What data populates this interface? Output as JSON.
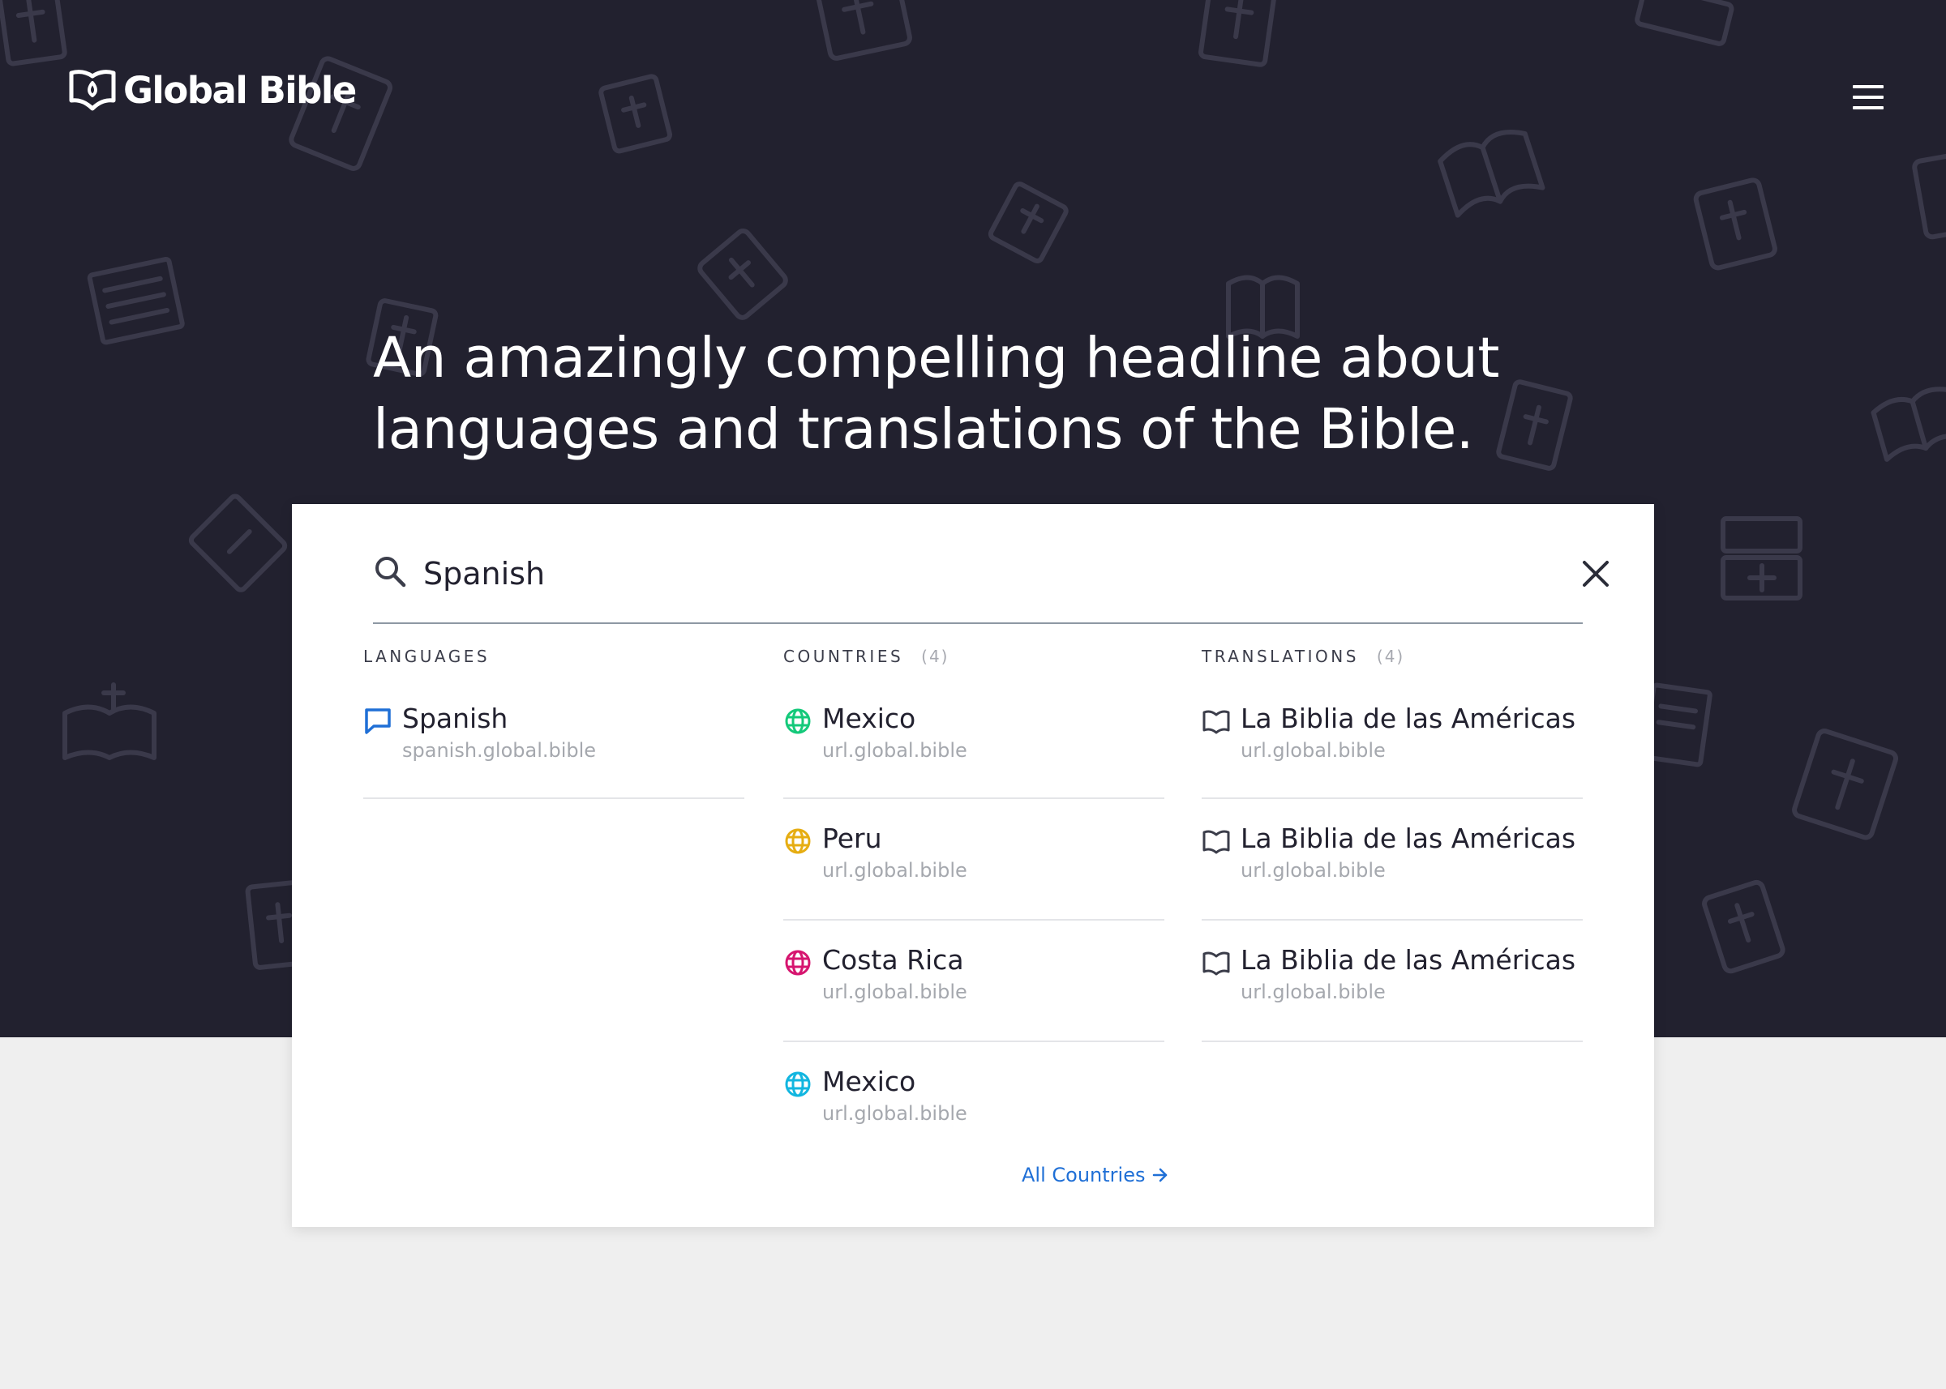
{
  "header": {
    "logo_text": "Global Bible",
    "logo_icon": "open-book-icon",
    "menu_icon": "hamburger-menu-icon"
  },
  "hero": {
    "headline_line1": "An amazingly compelling headline about",
    "headline_line2": "languages and translations of the Bible."
  },
  "search": {
    "value": "Spanish",
    "search_icon": "search-icon",
    "clear_icon": "close-icon"
  },
  "languages": {
    "header": "Languages",
    "items": [
      {
        "title": "Spanish",
        "url": "spanish.global.bible",
        "icon": "speech-bubble-icon",
        "color": "#1f6fd6"
      }
    ]
  },
  "countries": {
    "header": "Countries",
    "count": "(4)",
    "items": [
      {
        "title": "Mexico",
        "url": "url.global.bible",
        "icon": "globe-icon",
        "color": "#14c97a"
      },
      {
        "title": "Peru",
        "url": "url.global.bible",
        "icon": "globe-icon",
        "color": "#e6ad12"
      },
      {
        "title": "Costa Rica",
        "url": "url.global.bible",
        "icon": "globe-icon",
        "color": "#d6156f"
      },
      {
        "title": "Mexico",
        "url": "url.global.bible",
        "icon": "globe-icon",
        "color": "#12b6e0"
      }
    ],
    "all_link": "All Countries"
  },
  "translations": {
    "header": "Translations",
    "count": "(4)",
    "items": [
      {
        "title": "La Biblia de las Américas",
        "url": "url.global.bible",
        "icon": "open-book-icon"
      },
      {
        "title": "La Biblia de las Américas",
        "url": "url.global.bible",
        "icon": "open-book-icon"
      },
      {
        "title": "La Biblia de las Américas",
        "url": "url.global.bible",
        "icon": "open-book-icon"
      }
    ]
  },
  "colors": {
    "hero_background": "#22212f",
    "page_background": "#efefef",
    "link": "#1f6fd6"
  }
}
